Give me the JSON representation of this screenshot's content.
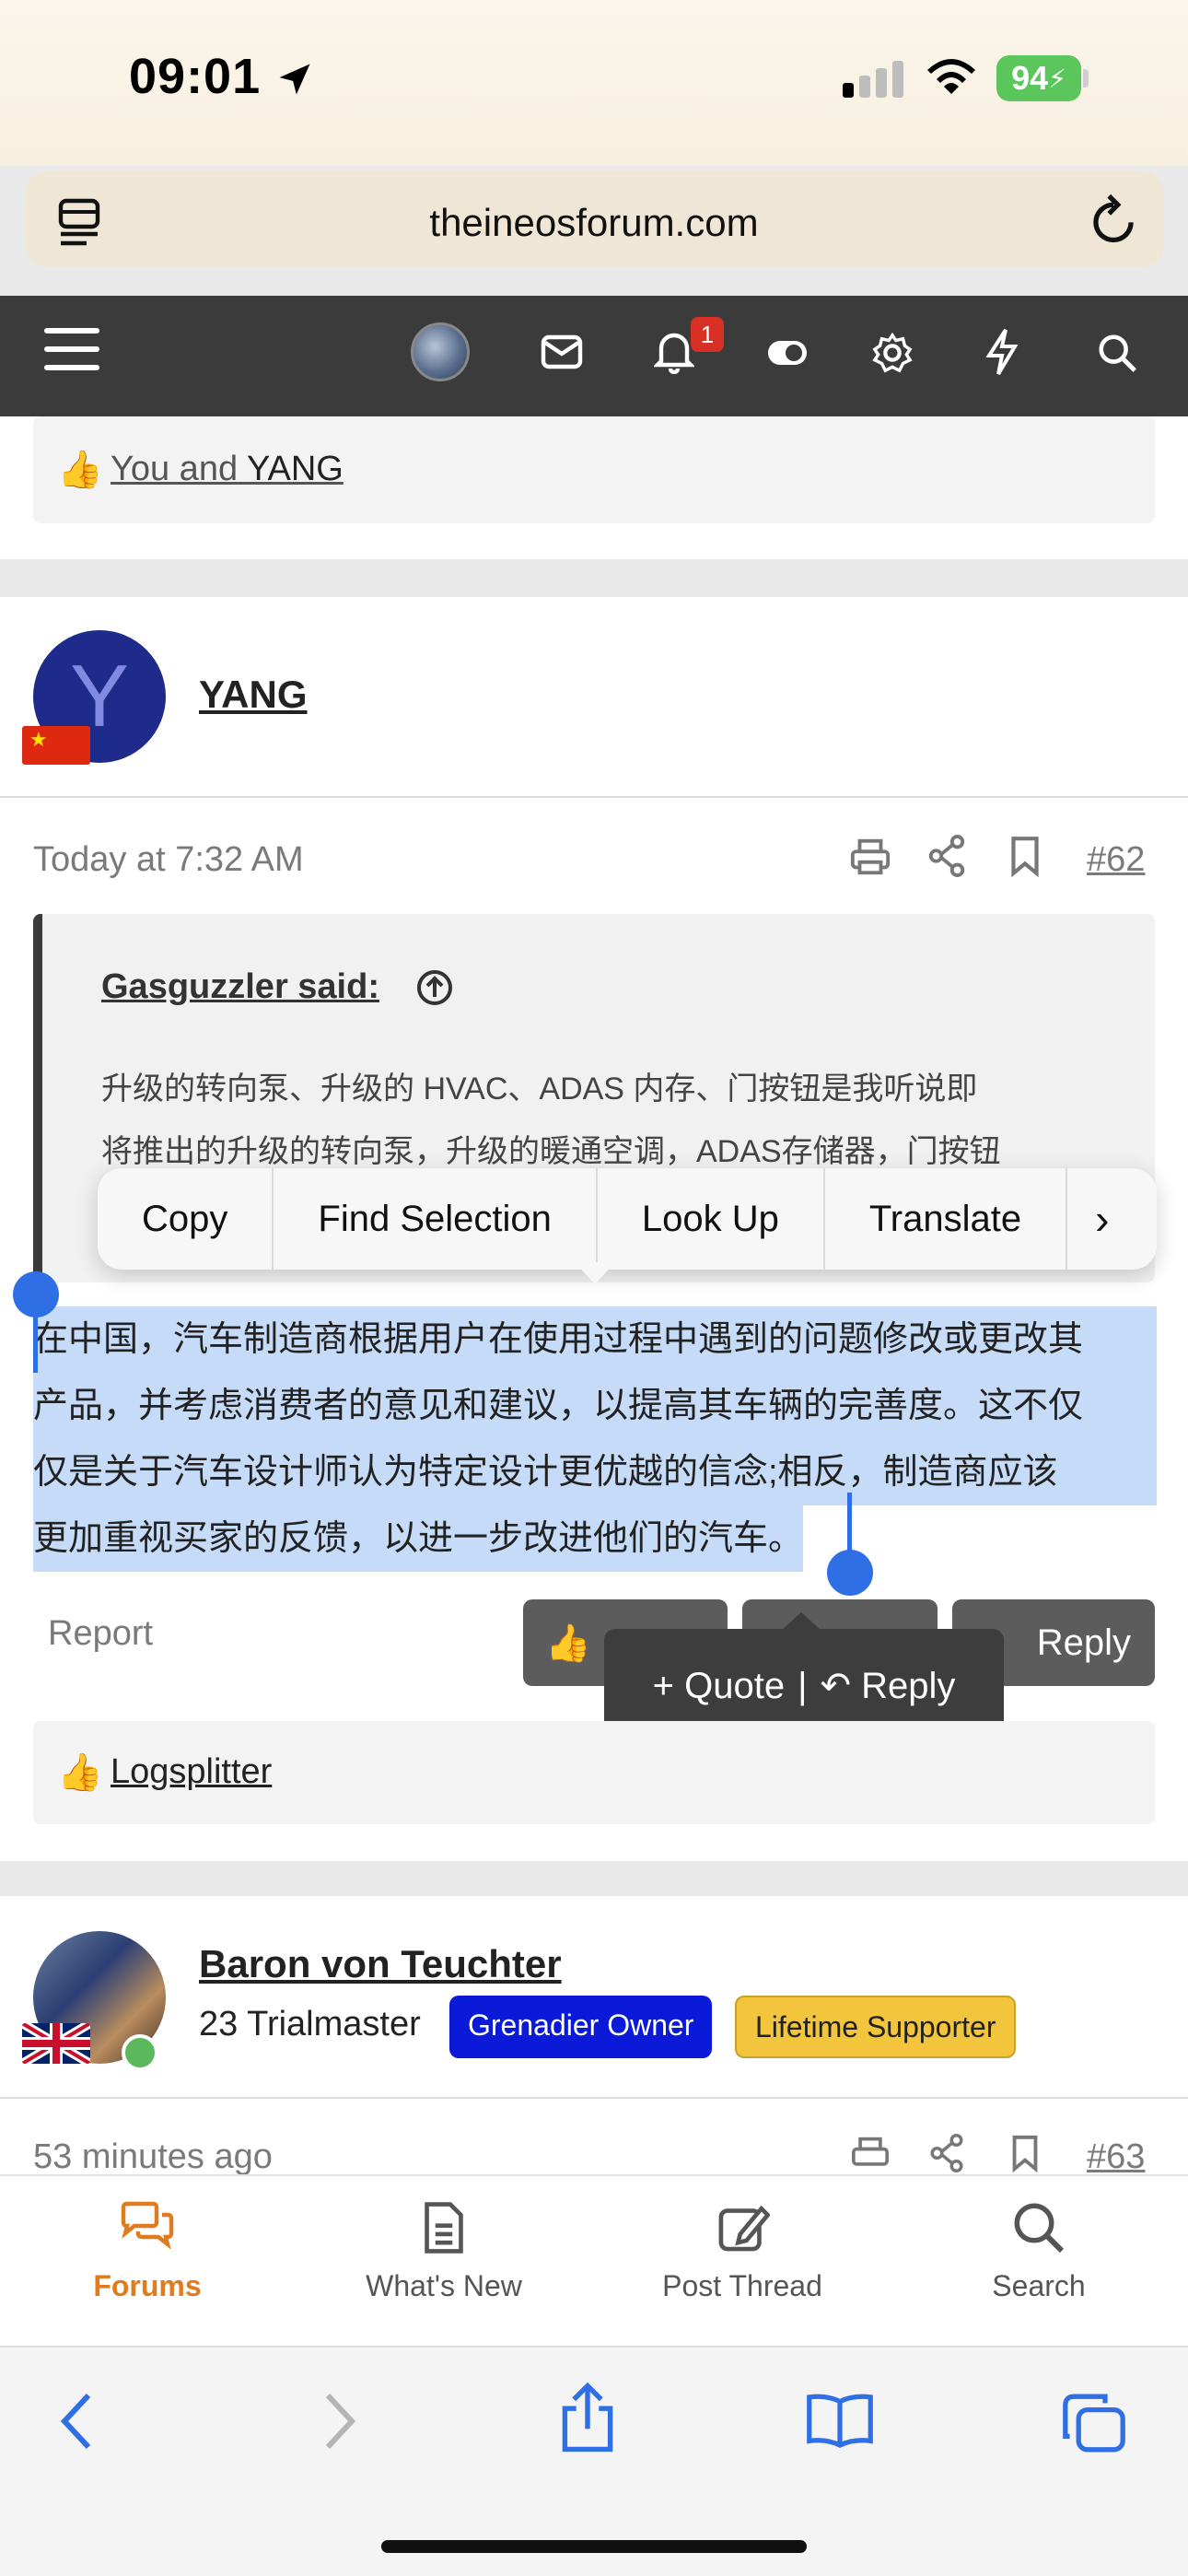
{
  "status_bar": {
    "time": "09:01",
    "battery": "94"
  },
  "browser": {
    "url": "theineosforum.com"
  },
  "forum_nav": {
    "notification_count": "1"
  },
  "prev_post": {
    "reaction_prefix": "You and",
    "reaction_user": "YANG"
  },
  "post62": {
    "username": "YANG",
    "avatar_letter": "Y",
    "timestamp": "Today at 7:32 AM",
    "post_number": "#62",
    "quote_author": "Gasguzzler said:",
    "quote_lines": [
      "升级的转向泵、升级的 HVAC、ADAS 内存、门按钮是我听说即",
      "将推出的升级的转向泵，升级的暖通空调，ADAS存储器，门按钮"
    ],
    "body_lines": [
      "在中国，汽车制造商根据用户在使用过程中遇到的问题修改或更改其",
      "产品，并考虑消费者的意见和建议，以提高其车辆的完善度。这不仅",
      "仅是关于汽车设计师认为特定设计更优越的信念;相反，制造商应该",
      "更加重视买家的反馈，以进一步改进他们的汽车。"
    ],
    "report_label": "Report",
    "reply_label": "Reply",
    "reaction_user": "Logsplitter"
  },
  "context_menu": {
    "items": [
      "Copy",
      "Find Selection",
      "Look Up",
      "Translate"
    ]
  },
  "quote_reply_popup": {
    "quote_label": "Quote",
    "separator": "|",
    "reply_label": "Reply"
  },
  "post63": {
    "username": "Baron von Teuchter",
    "title": "23 Trialmaster",
    "badge1": "Grenadier Owner",
    "badge2": "Lifetime Supporter",
    "timestamp": "53 minutes ago",
    "post_number": "#63"
  },
  "tabbar": {
    "items": [
      "Forums",
      "What's New",
      "Post Thread",
      "Search"
    ]
  },
  "colors": {
    "accent": "#e07b1f",
    "selection": "#c6dbf7",
    "handle": "#2f6fe6",
    "badge_blue": "#0a1ad8",
    "badge_yellow": "#f2c53d"
  }
}
